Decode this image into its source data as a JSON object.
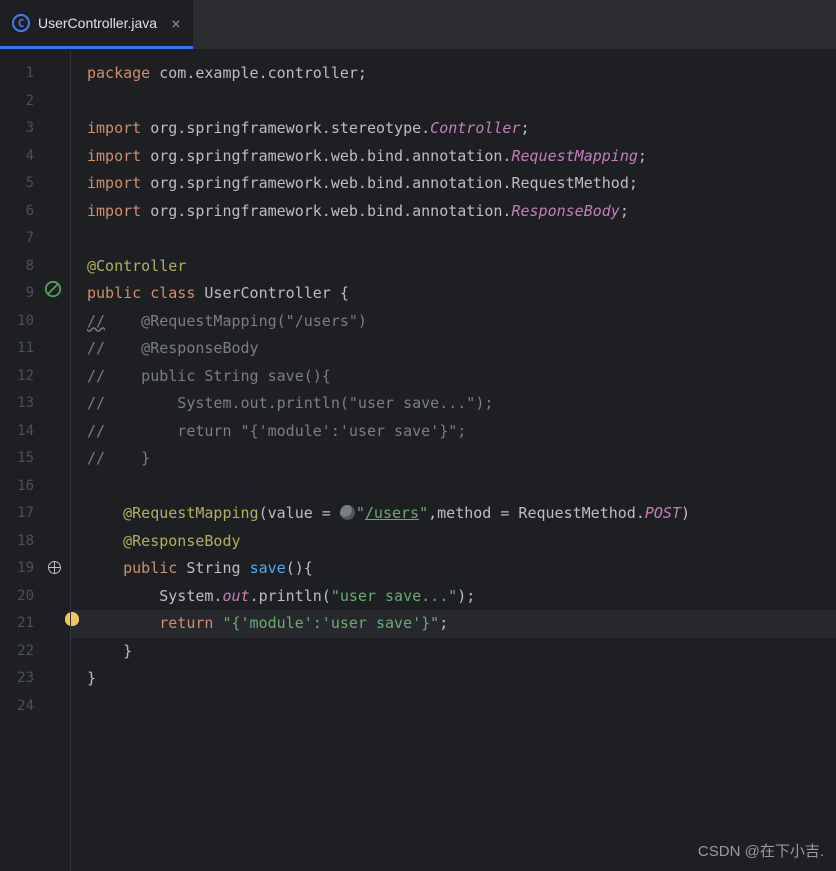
{
  "tab": {
    "title": "UserController.java"
  },
  "code": {
    "package_kw": "package",
    "package_name": " com.example.controller;",
    "import_kw": "import",
    "import1_pkg": " org.springframework.stereotype.",
    "import1_cls": "Controller",
    "import2_pkg": " org.springframework.web.bind.annotation.",
    "import2_cls": "RequestMapping",
    "import3_pkg": " org.springframework.web.bind.annotation.RequestMethod;",
    "import4_pkg": " org.springframework.web.bind.annotation.",
    "import4_cls": "ResponseBody",
    "semicolon": ";",
    "ann_controller": "@Controller",
    "public_kw": "public",
    "class_kw": "class",
    "class_name": " UserController ",
    "brace_open": "{",
    "brace_close": "}",
    "cmt_a": "//",
    "cmt_a_rest": "    @RequestMapping(\"/users\")",
    "cmt_b": "//    @ResponseBody",
    "cmt_c": "//    public String save(){",
    "cmt_d": "//        System.out.println(\"user save...\");",
    "cmt_e": "//        return \"{'module':'user save'}\";",
    "cmt_f": "//    }",
    "ann_reqmap": "@RequestMapping",
    "reqmap_open": "(value = ",
    "reqmap_q1": "\"",
    "reqmap_path": "/users",
    "reqmap_q2": "\"",
    "reqmap_mid": ",method = RequestMethod.",
    "reqmap_post": "POST",
    "reqmap_close": ")",
    "ann_respbody": "@ResponseBody",
    "ret_type": " String ",
    "method_name": "save",
    "method_paren": "()",
    "sys": "System.",
    "out": "out",
    "println": ".println(",
    "msg": "\"user save...\"",
    "println_close": ");",
    "return_kw": "return",
    "ret_str": " \"{'module':'user save'}\"",
    "ret_semi": ";"
  },
  "watermark": "CSDN @在下小吉."
}
